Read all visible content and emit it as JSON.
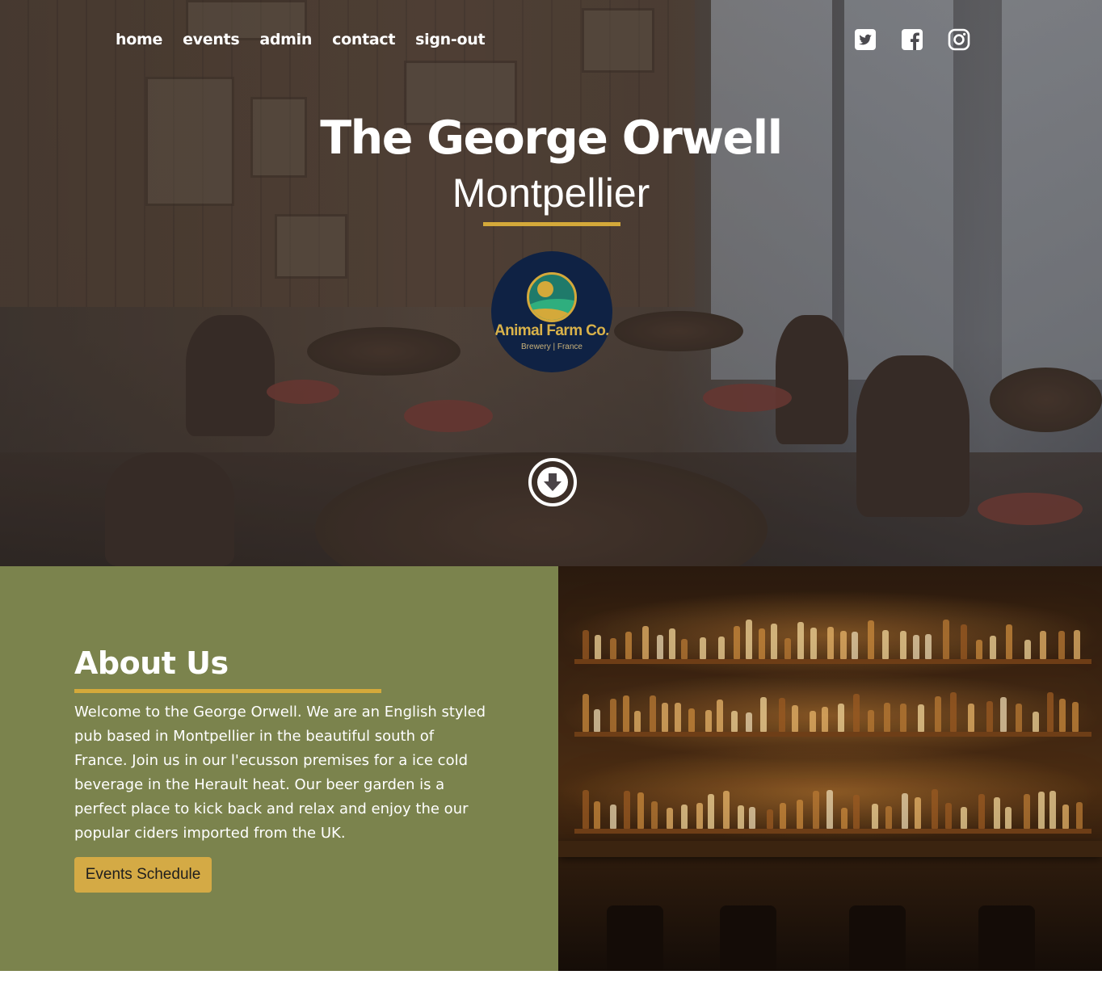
{
  "nav": {
    "items": [
      {
        "label": "home"
      },
      {
        "label": "events"
      },
      {
        "label": "admin"
      },
      {
        "label": "contact"
      },
      {
        "label": "sign-out"
      }
    ]
  },
  "social": {
    "icons": [
      "twitter-icon",
      "facebook-icon",
      "instagram-icon"
    ]
  },
  "hero": {
    "title": "The George Orwell",
    "subtitle": "Montpellier",
    "logo_brand": "Animal Farm Co.",
    "logo_tagline": "Brewery | France",
    "scroll_icon": "arrow-down-circle-icon"
  },
  "about": {
    "heading": "About Us",
    "body": "Welcome to the George Orwell. We are an English styled pub based in Montpellier in the beautiful south of France. Join us in our l'ecusson premises for a ice cold beverage in the Herault heat. Our beer garden is a perfect place to kick back and relax and enjoy the our popular ciders imported from the UK.",
    "button_label": "Events Schedule"
  },
  "colors": {
    "accent": "#d4a93a",
    "about_bg": "#7b834d",
    "logo_bg": "#0f2244"
  }
}
